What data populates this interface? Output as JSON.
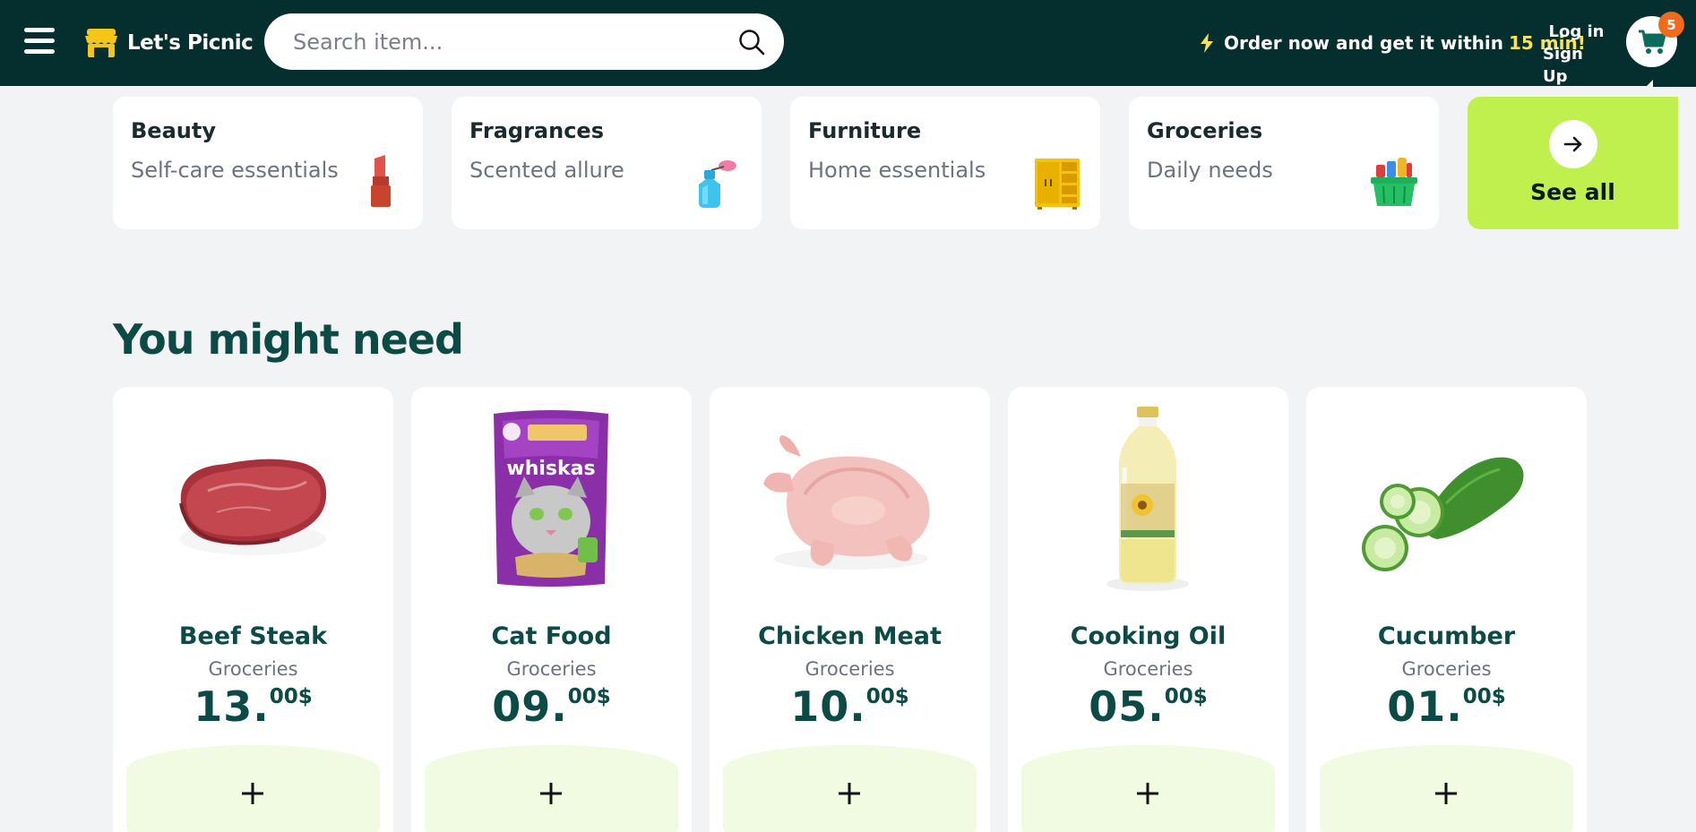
{
  "header": {
    "brand": "Let's Picnic",
    "search_placeholder": "Search item...",
    "promo_text": "Order now and get it within",
    "promo_highlight": "15 min!",
    "login_label": "Log in",
    "signup_label": "Sign Up",
    "cart_count": "5",
    "colors": {
      "bg": "#042f2e",
      "accent": "#f8e25a",
      "badge": "#f26b1d"
    }
  },
  "categories": [
    {
      "title": "Beauty",
      "subtitle": "Self-care essentials",
      "icon": "lipstick-icon"
    },
    {
      "title": "Fragrances",
      "subtitle": "Scented allure",
      "icon": "perfume-icon"
    },
    {
      "title": "Furniture",
      "subtitle": "Home essentials",
      "icon": "wardrobe-icon"
    },
    {
      "title": "Groceries",
      "subtitle": "Daily needs",
      "icon": "basket-icon"
    }
  ],
  "see_all_label": "See all",
  "section_title": "You might need",
  "products": [
    {
      "name": "Beef Steak",
      "category": "Groceries",
      "price_int": "13.",
      "price_dec": "00$",
      "image": "beef-steak-image"
    },
    {
      "name": "Cat Food",
      "category": "Groceries",
      "price_int": "09.",
      "price_dec": "00$",
      "image": "cat-food-image"
    },
    {
      "name": "Chicken Meat",
      "category": "Groceries",
      "price_int": "10.",
      "price_dec": "00$",
      "image": "chicken-image"
    },
    {
      "name": "Cooking Oil",
      "category": "Groceries",
      "price_int": "05.",
      "price_dec": "00$",
      "image": "cooking-oil-image"
    },
    {
      "name": "Cucumber",
      "category": "Groceries",
      "price_int": "01.",
      "price_dec": "00$",
      "image": "cucumber-image"
    }
  ],
  "product_image_labels": {
    "cat_food_brand": "whiskas"
  }
}
